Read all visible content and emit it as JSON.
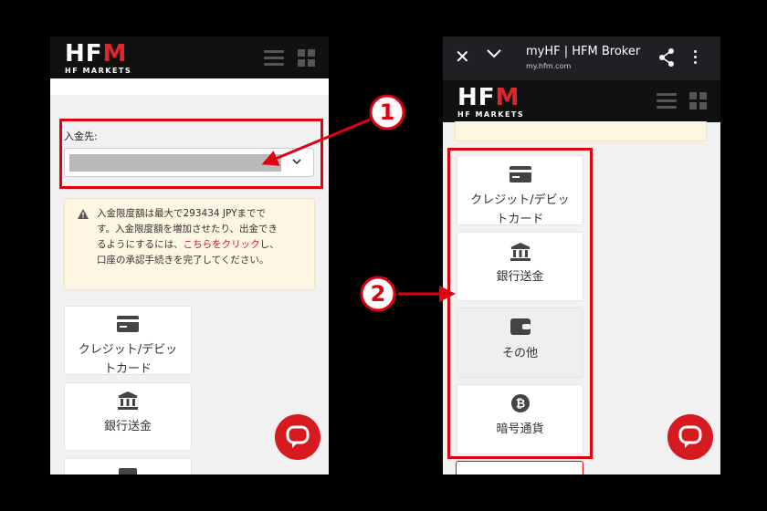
{
  "left": {
    "logo": {
      "main": "HF",
      "accent": "M",
      "sub": "HF MARKETS"
    },
    "deposit_to_label": "入金先:",
    "notice": {
      "line1": "入金限度額は最大で293434 JPYまでで",
      "line2": "す。入金限度額を増加させたり、出金でき",
      "line3_pre": "るようにするには、",
      "link": "こちらをクリック",
      "line3_post": "し、",
      "line4": "口座の承認手続きを完了してください。"
    },
    "methods": [
      {
        "label_1": "クレジット/デビッ",
        "label_2": "トカード",
        "icon": "credit-card-icon"
      },
      {
        "label": "銀行送金",
        "icon": "bank-icon"
      }
    ]
  },
  "right": {
    "browser": {
      "title": "myHF | HFM Broker",
      "url": "my.hfm.com"
    },
    "logo": {
      "main": "HF",
      "accent": "M",
      "sub": "HF MARKETS"
    },
    "methods": [
      {
        "label_1": "クレジット/デビッ",
        "label_2": "トカード",
        "icon": "credit-card-icon"
      },
      {
        "label": "銀行送金",
        "icon": "bank-icon"
      },
      {
        "label": "その他",
        "icon": "wallet-icon"
      },
      {
        "label": "暗号通貨",
        "icon": "bitcoin-icon"
      }
    ]
  },
  "callouts": [
    "1",
    "2"
  ],
  "colors": {
    "accent_red": "#e00012",
    "brand_red": "#d71920",
    "header_dark": "#111111",
    "notice_bg": "#fdf6e3"
  }
}
